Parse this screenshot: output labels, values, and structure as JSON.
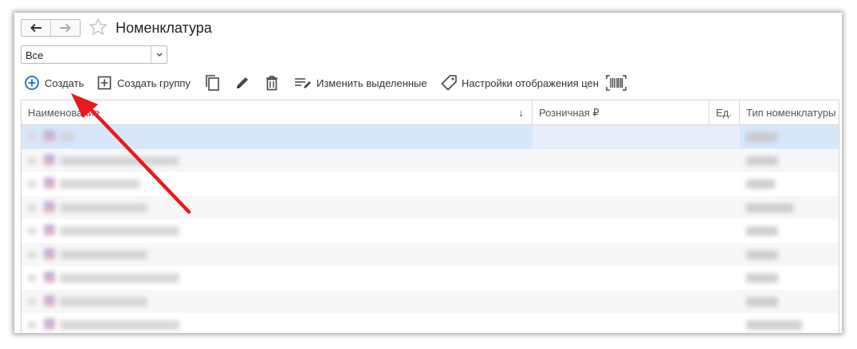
{
  "window": {
    "title": "Номенклатура"
  },
  "filter": {
    "selected": "Все"
  },
  "toolbar": {
    "create_label": "Создать",
    "create_group_label": "Создать группу",
    "edit_selected_label": "Изменить выделенные",
    "price_settings_label": "Настройки отображения цен"
  },
  "table": {
    "columns": [
      "Наименование",
      "Розничная ₽",
      "Ед.",
      "Тип номенклатуры"
    ],
    "sort_indicator": "↓",
    "rows": [
      {
        "name": "",
        "price": "",
        "unit": "",
        "type": ""
      },
      {
        "name": "",
        "price": "",
        "unit": "",
        "type": ""
      },
      {
        "name": "",
        "price": "",
        "unit": "",
        "type": ""
      },
      {
        "name": "",
        "price": "",
        "unit": "",
        "type": ""
      },
      {
        "name": "",
        "price": "",
        "unit": "",
        "type": ""
      },
      {
        "name": "",
        "price": "",
        "unit": "",
        "type": ""
      },
      {
        "name": "",
        "price": "",
        "unit": "",
        "type": ""
      },
      {
        "name": "",
        "price": "",
        "unit": "",
        "type": ""
      },
      {
        "name": "",
        "price": "",
        "unit": "",
        "type": ""
      }
    ]
  },
  "colors": {
    "accent": "#1b6ec2",
    "selected_row": "#d6e7f9",
    "annotation_arrow": "#e8191d"
  },
  "icons": {
    "back": "arrow-left-icon",
    "forward": "arrow-right-icon",
    "favorite": "star-icon",
    "dropdown": "chevron-down-icon",
    "create": "plus-circle-icon",
    "create_group": "plus-square-icon",
    "copy": "copy-icon",
    "edit": "pencil-icon",
    "delete": "trash-icon",
    "edit_selected": "list-edit-icon",
    "price_settings": "tag-icon",
    "barcode": "barcode-icon"
  }
}
